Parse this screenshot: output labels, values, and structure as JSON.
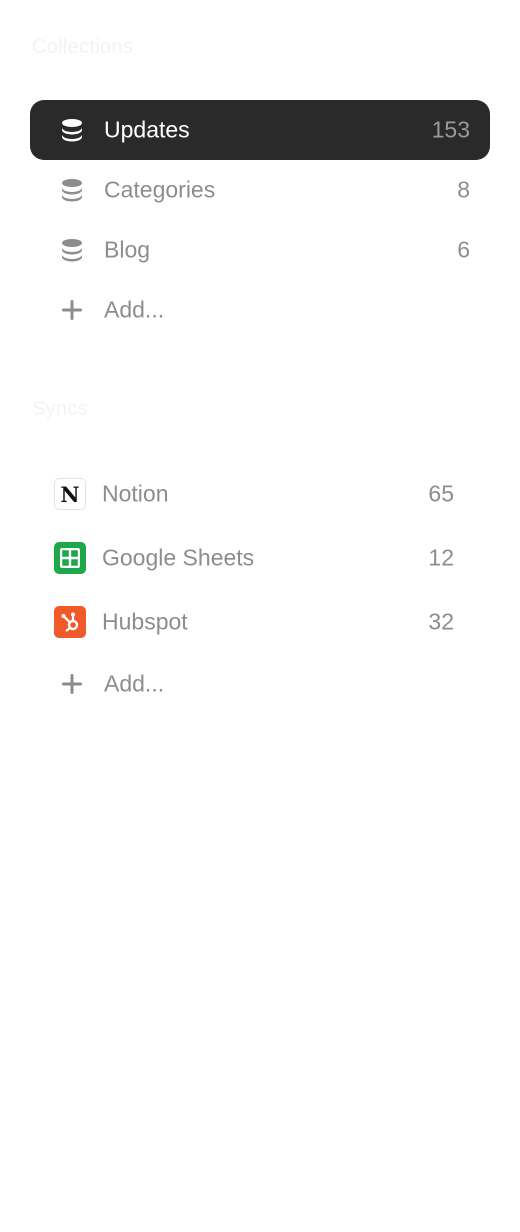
{
  "collections": {
    "title": "Collections",
    "items": [
      {
        "label": "Updates",
        "count": "153",
        "icon": "database-icon",
        "active": true
      },
      {
        "label": "Categories",
        "count": "8",
        "icon": "database-icon",
        "active": false
      },
      {
        "label": "Blog",
        "count": "6",
        "icon": "database-icon",
        "active": false
      }
    ],
    "add_label": "Add..."
  },
  "syncs": {
    "title": "Syncs",
    "items": [
      {
        "label": "Notion",
        "count": "65",
        "icon": "notion-icon",
        "glyph": "N"
      },
      {
        "label": "Google Sheets",
        "count": "12",
        "icon": "google-sheets-icon"
      },
      {
        "label": "Hubspot",
        "count": "32",
        "icon": "hubspot-icon"
      }
    ],
    "add_label": "Add..."
  },
  "colors": {
    "active_bg": "#2a2a2a",
    "text_muted": "#8d8d8d",
    "sheets_green": "#1ea84a",
    "hubspot_orange": "#f05a2a"
  }
}
